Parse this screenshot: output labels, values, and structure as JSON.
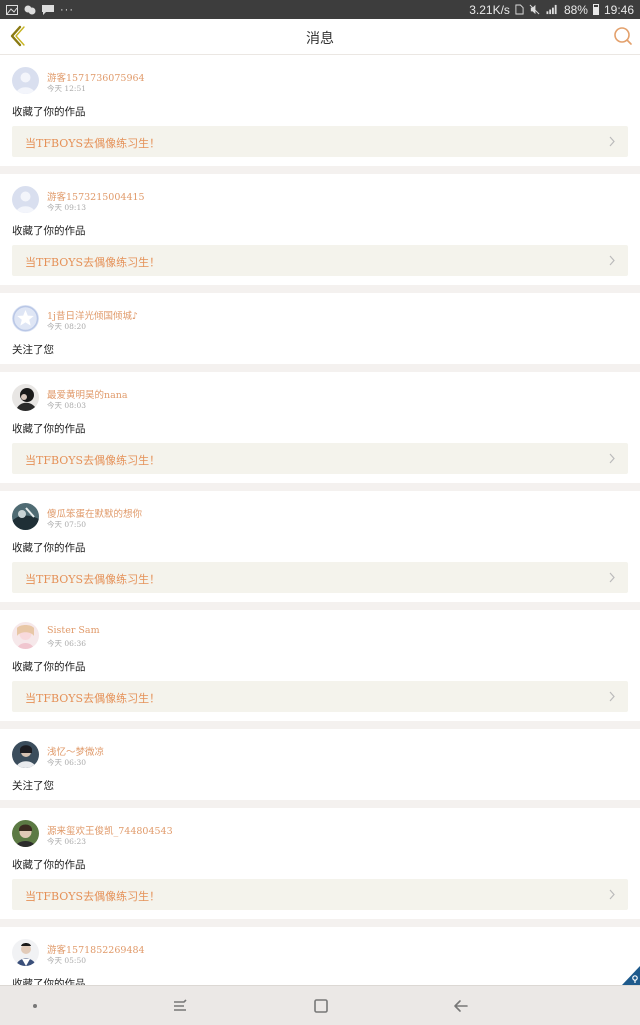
{
  "status_bar": {
    "speed": "3.21K/s",
    "battery": "88%",
    "time": "19:46",
    "dots": "···"
  },
  "header": {
    "title": "消息"
  },
  "messages": [
    {
      "username": "游客1571736075964",
      "time": "今天 12:51",
      "action": "收藏了你的作品",
      "work": "当TFBOYS去偶像练习生！",
      "avatar": "default-avatar"
    },
    {
      "username": "游客1573215004415",
      "time": "今天 09:13",
      "action": "收藏了你的作品",
      "work": "当TFBOYS去偶像练习生！",
      "avatar": "default-avatar"
    },
    {
      "username": "1j昔日洋光倾国倾城♪",
      "time": "今天 08:20",
      "action": "关注了您",
      "work": "",
      "avatar": "star-avatar"
    },
    {
      "username": "最爱黄明昊的nana",
      "time": "今天 08:03",
      "action": "收藏了你的作品",
      "work": "当TFBOYS去偶像练习生！",
      "avatar": "photo-avatar"
    },
    {
      "username": "傻瓜笨蛋在默默的想你",
      "time": "今天 07:50",
      "action": "收藏了你的作品",
      "work": "当TFBOYS去偶像练习生！",
      "avatar": "photo-avatar"
    },
    {
      "username": "Sister Sam",
      "time": "今天 06:36",
      "action": "收藏了你的作品",
      "work": "当TFBOYS去偶像练习生！",
      "avatar": "photo-avatar"
    },
    {
      "username": "浅忆～梦微凉",
      "time": "今天 06:30",
      "action": "关注了您",
      "work": "",
      "avatar": "photo-avatar"
    },
    {
      "username": "源来玺欢王俊凯_744804543",
      "time": "今天 06:23",
      "action": "收藏了你的作品",
      "work": "当TFBOYS去偶像练习生！",
      "avatar": "photo-avatar"
    },
    {
      "username": "游客1571852269484",
      "time": "今天 05:50",
      "action": "收藏了你的作品",
      "work": "",
      "avatar": "photo-avatar"
    }
  ],
  "colors": {
    "accent": "#e09a6a",
    "work_bg": "#f4f3ec",
    "back_arrow": "#8a7a12"
  }
}
